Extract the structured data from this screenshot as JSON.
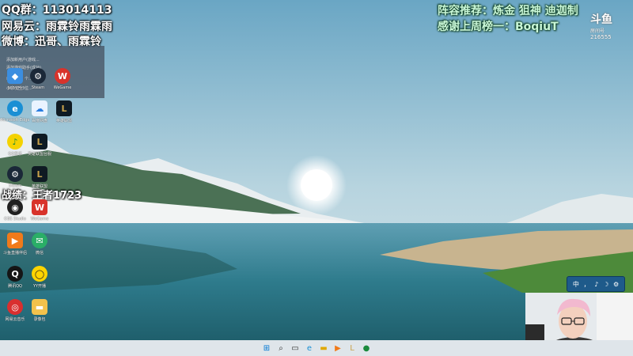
{
  "overlay": {
    "qq_group": "QQ群：113014113",
    "netease": "网易云：雨霖铃雨霖雨",
    "weibo": "微博：迅哥、雨霖铃",
    "record": "战绩：王者1723",
    "lineup": "阵容推荐：炼金 狙神 迪迦制",
    "thanks": "感谢上周榜一：BoqiuT"
  },
  "watermark": {
    "logo": "斗鱼",
    "sub": "房间号",
    "room_id": "216555"
  },
  "panel_rows": [
    "添加新用户(游戏...",
    "添加游戏助手(成功)",
    "已关闭: 2 个...",
    "小宁: 王 3位..."
  ],
  "desktop_icons": [
    {
      "name": "360",
      "label": "360安全"
    },
    {
      "name": "steam",
      "label": "Steam"
    },
    {
      "name": "wegame",
      "label": "WeGame"
    },
    {
      "name": "edge",
      "label": "Microsoft Edge"
    },
    {
      "name": "cloud",
      "label": "百度网盘"
    },
    {
      "name": "lol",
      "label": "英雄联盟"
    },
    {
      "name": "qqmusic",
      "label": "QQ音乐"
    },
    {
      "name": "lol-tw",
      "label": "英雄联盟台服"
    },
    {
      "name": "steam2",
      "label": "Steam"
    },
    {
      "name": "lol2",
      "label": "英雄联盟"
    },
    {
      "name": "obs",
      "label": "OBS Studio"
    },
    {
      "name": "wegame2",
      "label": "WeGame"
    },
    {
      "name": "sohu",
      "label": "斗鱼直播伴侣"
    },
    {
      "name": "wechat",
      "label": "微信"
    },
    {
      "name": "qq",
      "label": "腾讯QQ"
    },
    {
      "name": "yy",
      "label": "YY开播"
    },
    {
      "name": "netease",
      "label": "网易云音乐"
    },
    {
      "name": "folder",
      "label": "录像包"
    }
  ],
  "ime": [
    "中",
    "，",
    "♪",
    "☽",
    "⚙"
  ],
  "colors": {
    "taskbar": "#dfe5ea",
    "accent": "#0078d4"
  }
}
